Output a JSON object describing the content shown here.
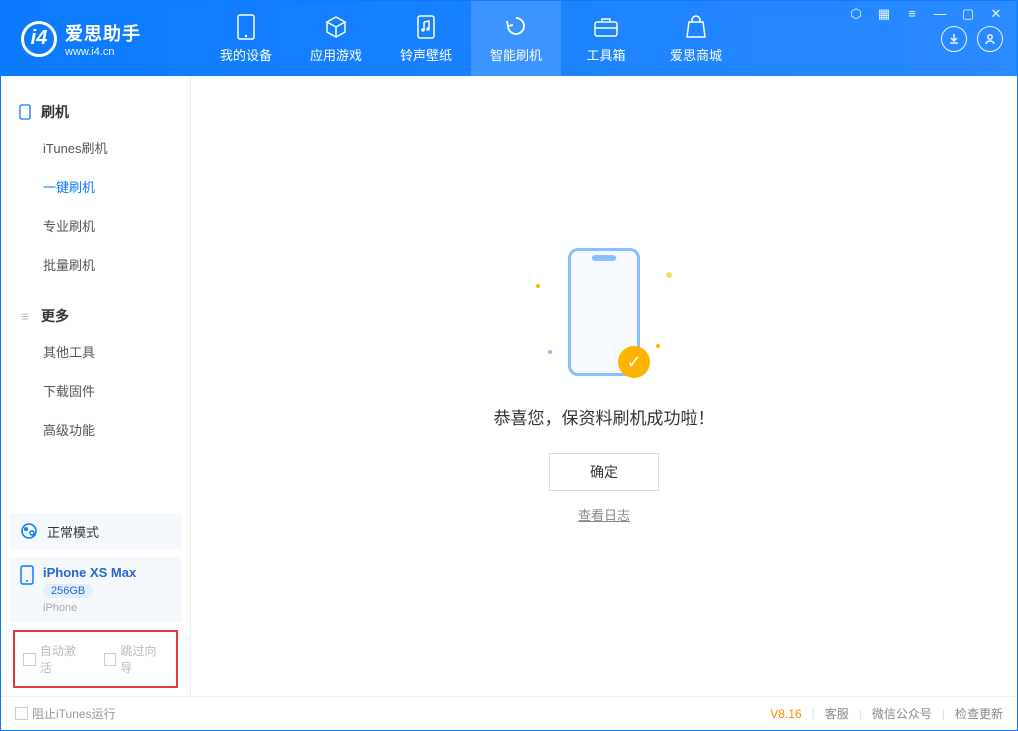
{
  "app": {
    "name": "爱思助手",
    "url": "www.i4.cn"
  },
  "nav": {
    "my_device": "我的设备",
    "apps_games": "应用游戏",
    "ringtones": "铃声壁纸",
    "smart_flash": "智能刷机",
    "toolbox": "工具箱",
    "store": "爱思商城"
  },
  "sidebar": {
    "flash_group": "刷机",
    "items_flash": {
      "itunes": "iTunes刷机",
      "onekey": "一键刷机",
      "pro": "专业刷机",
      "batch": "批量刷机"
    },
    "more_group": "更多",
    "items_more": {
      "other_tools": "其他工具",
      "download_fw": "下载固件",
      "advanced": "高级功能"
    },
    "mode_card": "正常模式",
    "device": {
      "name": "iPhone XS Max",
      "capacity": "256GB",
      "type": "iPhone"
    },
    "checks": {
      "auto_activate": "自动激活",
      "skip_guide": "跳过向导"
    }
  },
  "main": {
    "message": "恭喜您，保资料刷机成功啦！",
    "ok": "确定",
    "view_log": "查看日志"
  },
  "status": {
    "block_itunes": "阻止iTunes运行",
    "version": "V8.16",
    "support": "客服",
    "wechat": "微信公众号",
    "check_update": "检查更新"
  }
}
